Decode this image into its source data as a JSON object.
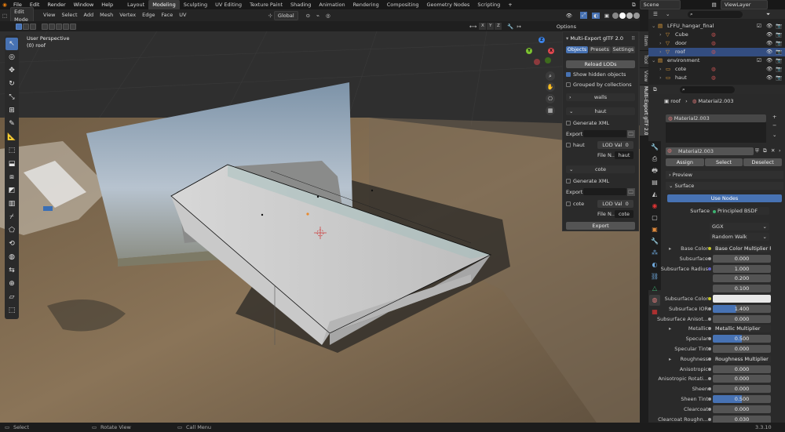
{
  "topbar": {
    "menus": [
      "File",
      "Edit",
      "Render",
      "Window",
      "Help"
    ],
    "workspaces": [
      "Layout",
      "Modeling",
      "Sculpting",
      "UV Editing",
      "Texture Paint",
      "Shading",
      "Animation",
      "Rendering",
      "Compositing",
      "Geometry Nodes",
      "Scripting"
    ],
    "active_workspace": "Modeling",
    "add_tab": "+",
    "scene": "Scene",
    "view_layer": "ViewLayer"
  },
  "viewport_header": {
    "mode": "Edit Mode",
    "menus": [
      "View",
      "Select",
      "Add",
      "Mesh",
      "Vertex",
      "Edge",
      "Face",
      "UV"
    ],
    "transform_orientation": "Global",
    "axes": [
      "X",
      "Y",
      "Z"
    ],
    "options": "Options"
  },
  "viewport": {
    "perspective": "User Perspective",
    "object_label": "(0) roof"
  },
  "npanel": {
    "title": "Multi-Export glTF 2.0",
    "tabs": [
      "Objects",
      "Presets",
      "Settings"
    ],
    "reload": "Reload LODs",
    "show_hidden": "Show hidden objects",
    "grouped": "Grouped by collections",
    "walls": "walls",
    "haut_section": {
      "title": "haut",
      "generate_xml": "Generate XML",
      "export_path": "Export...",
      "name": "haut",
      "lod": "LOD Val",
      "lod_value": "0",
      "file_label": "File N...",
      "file_value": "haut"
    },
    "cote_section": {
      "title": "cote",
      "generate_xml": "Generate XML",
      "export_path": "Export...",
      "name": "cote",
      "lod": "LOD Val",
      "lod_value": "0",
      "file_label": "File N...",
      "file_value": "cote"
    },
    "export": "Export"
  },
  "side_tabs": [
    "Item",
    "Tool",
    "View",
    "Multi-Export glTF 2.0"
  ],
  "outliner": {
    "rows": [
      {
        "name": "LFFU_hangar_final",
        "indent": 1
      },
      {
        "name": "Cube",
        "indent": 2
      },
      {
        "name": "door",
        "indent": 2
      },
      {
        "name": "roof",
        "indent": 2,
        "selected": true
      },
      {
        "name": "environment",
        "indent": 1
      },
      {
        "name": "cote",
        "indent": 2
      },
      {
        "name": "haut",
        "indent": 2
      }
    ]
  },
  "properties": {
    "breadcrumb_object": "roof",
    "breadcrumb_material": "Material2.003",
    "slot": "Material2.003",
    "material_name": "Material2.003",
    "assign": "Assign",
    "select": "Select",
    "deselect": "Deselect",
    "preview": "Preview",
    "surface_header": "Surface",
    "use_nodes": "Use Nodes",
    "surface_label": "Surface",
    "surface_value": "Principled BSDF",
    "distribution": "GGX",
    "subsurface_method": "Random Walk",
    "rows": [
      {
        "label": "Base Color",
        "value": "Base Color Multiplier R...",
        "dot": "yellow",
        "expand": true
      },
      {
        "label": "Subsurface",
        "value": "0.000",
        "dot": "gray"
      },
      {
        "label": "Subsurface Radius",
        "value": "1.000",
        "dot": "blue"
      },
      {
        "label": "",
        "value": "0.200"
      },
      {
        "label": "",
        "value": "0.100"
      },
      {
        "label": "Subsurface Color",
        "value": "",
        "dot": "yellow",
        "swatch": true
      },
      {
        "label": "Subsurface IOR",
        "value": "1.400",
        "dot": "gray",
        "fill": 0.4
      },
      {
        "label": "Subsurface Anisot...",
        "value": "0.000",
        "dot": "gray"
      },
      {
        "label": "Metallic",
        "value": "Metallic Multiplier",
        "dot": "gray",
        "expand": true
      },
      {
        "label": "Specular",
        "value": "0.500",
        "dot": "gray",
        "fill": 0.5
      },
      {
        "label": "Specular Tint",
        "value": "0.000",
        "dot": "gray"
      },
      {
        "label": "Roughness",
        "value": "Roughness Multiplier",
        "dot": "gray",
        "expand": true
      },
      {
        "label": "Anisotropic",
        "value": "0.000",
        "dot": "gray"
      },
      {
        "label": "Anisotropic Rotati...",
        "value": "0.000",
        "dot": "gray"
      },
      {
        "label": "Sheen",
        "value": "0.000",
        "dot": "gray"
      },
      {
        "label": "Sheen Tint",
        "value": "0.500",
        "dot": "gray",
        "fill": 0.5
      },
      {
        "label": "Clearcoat",
        "value": "0.000",
        "dot": "gray"
      },
      {
        "label": "Clearcoat Roughn...",
        "value": "0.030",
        "dot": "gray"
      }
    ]
  },
  "statusbar": {
    "select": "Select",
    "rotate": "Rotate View",
    "menu": "Call Menu",
    "version": "3.3.10"
  },
  "colors": {
    "accent": "#4772b3",
    "selected_row": "#334d80"
  }
}
